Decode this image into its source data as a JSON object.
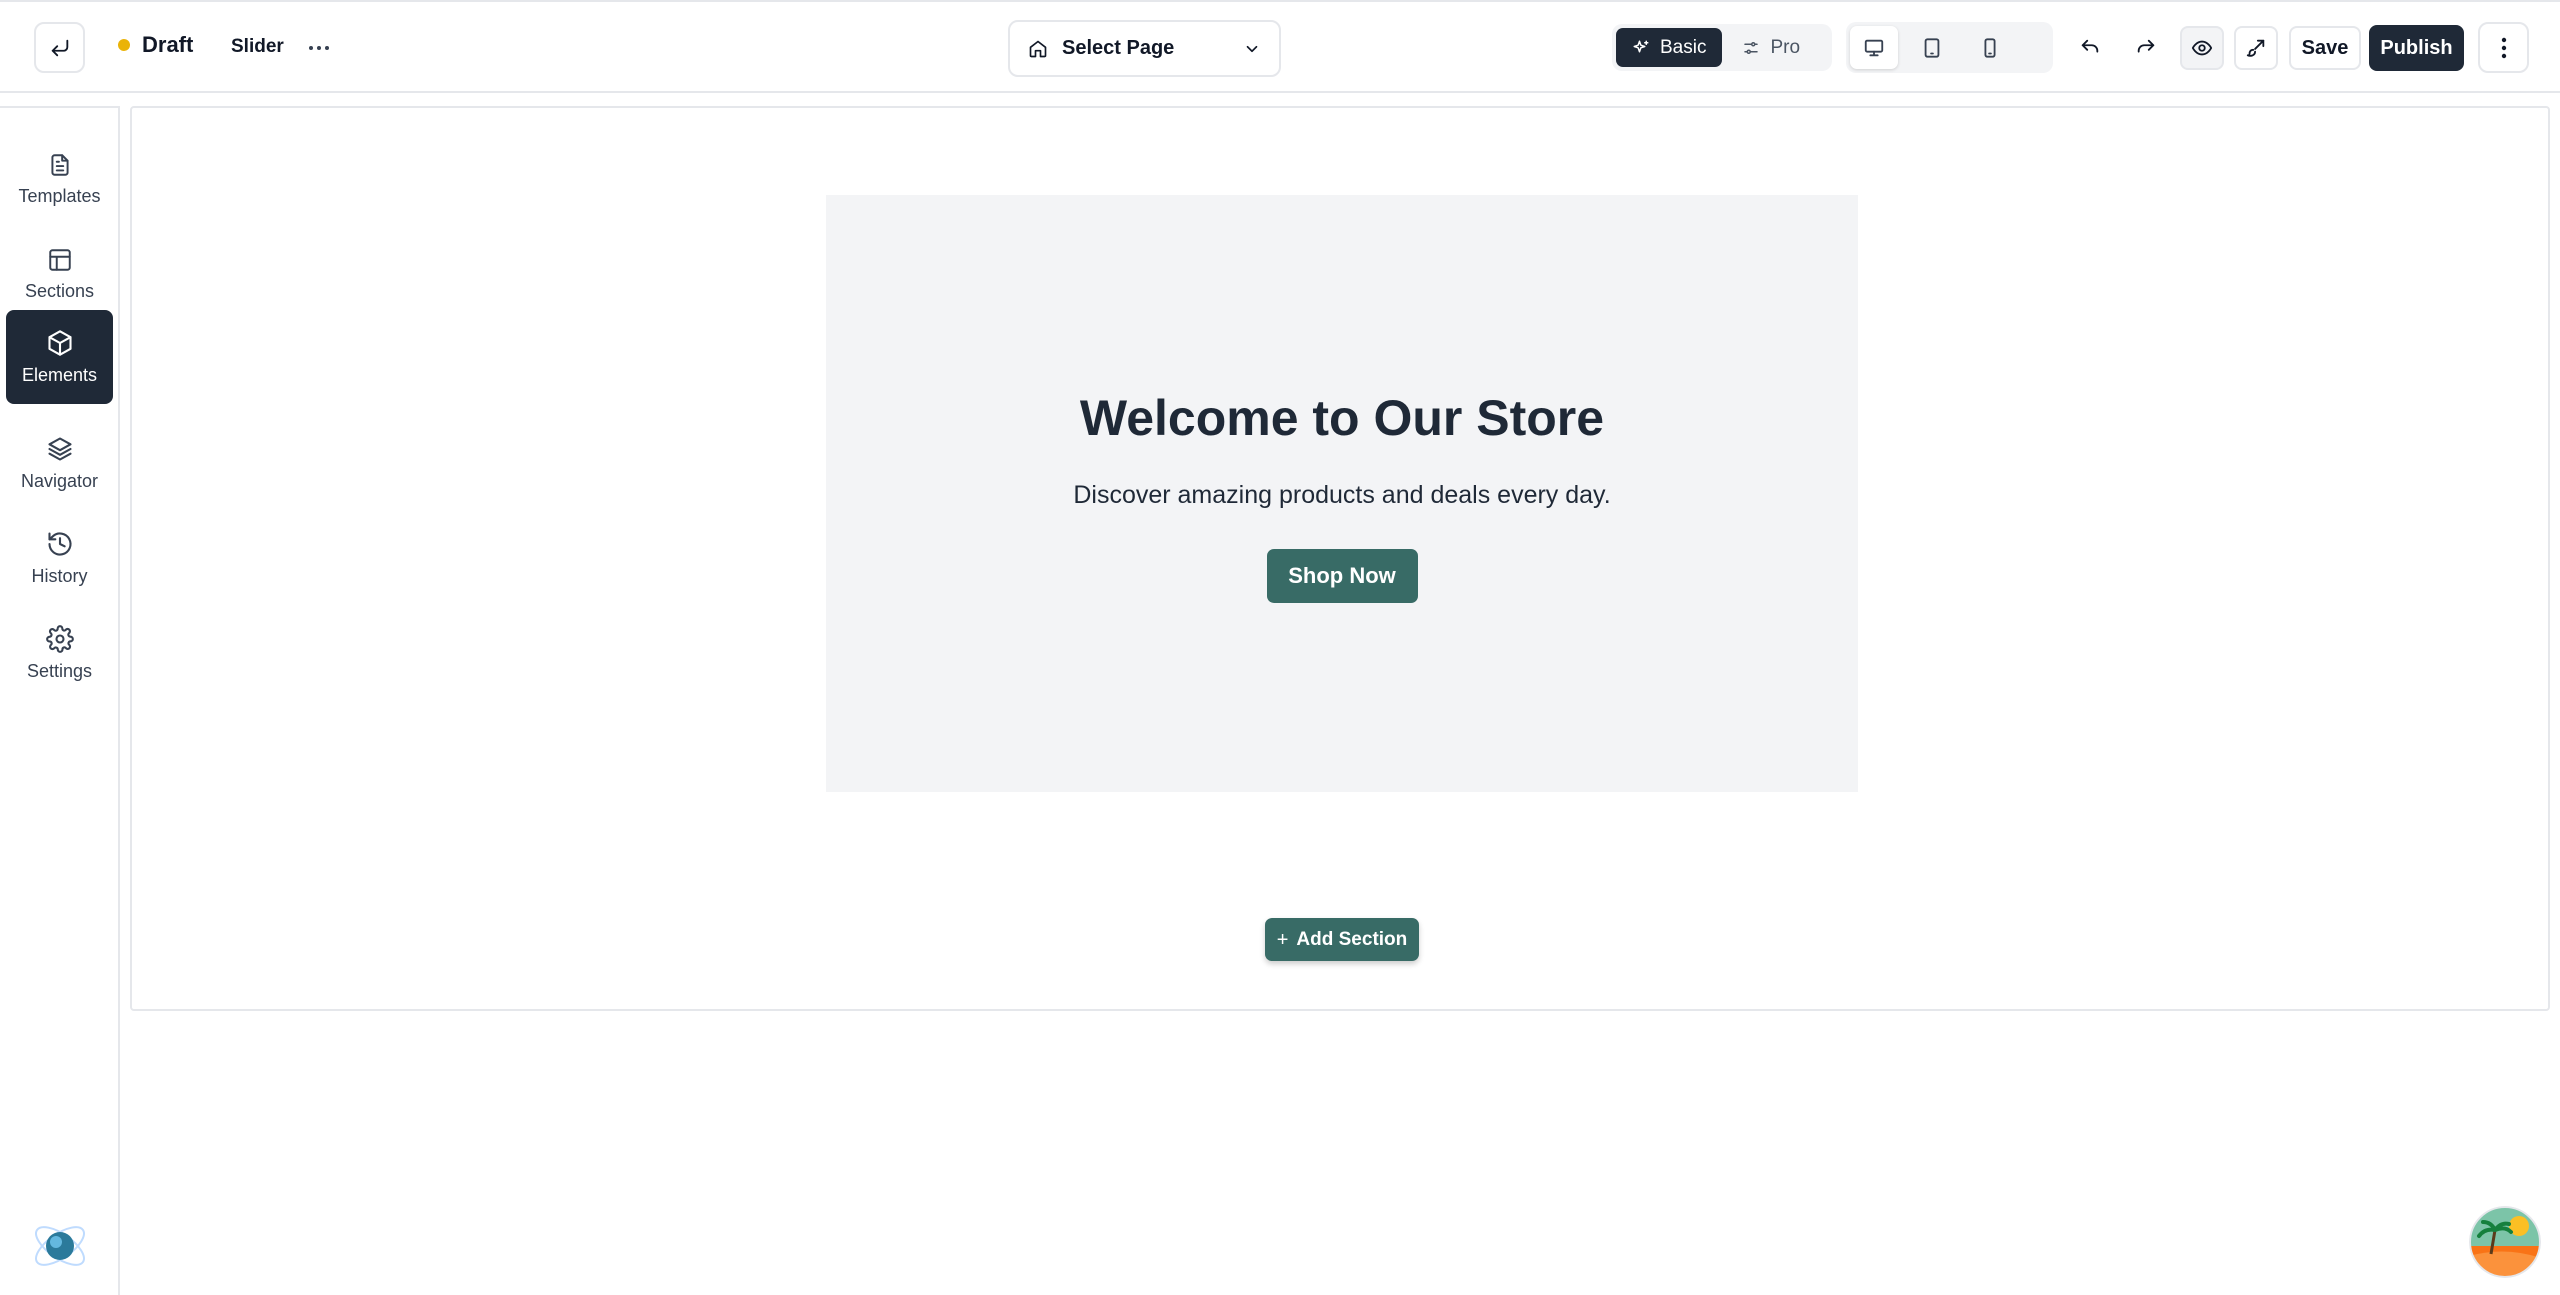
{
  "topbar": {
    "status_label": "Draft",
    "page_name": "Slider",
    "select_page": {
      "label": "Select Page"
    },
    "modes": [
      {
        "label": "Basic",
        "active": true
      },
      {
        "label": "Pro",
        "active": false
      }
    ],
    "devices": [
      "desktop",
      "tablet",
      "mobile"
    ],
    "active_device": "desktop",
    "save_label": "Save",
    "publish_label": "Publish"
  },
  "sidebar": {
    "items": [
      {
        "label": "Templates",
        "icon": "document-icon"
      },
      {
        "label": "Sections",
        "icon": "layout-icon"
      },
      {
        "label": "Elements",
        "icon": "cube-icon",
        "active": true
      },
      {
        "label": "Navigator",
        "icon": "layers-icon"
      },
      {
        "label": "History",
        "icon": "history-icon"
      },
      {
        "label": "Settings",
        "icon": "gear-icon"
      }
    ]
  },
  "canvas": {
    "hero": {
      "title": "Welcome to Our Store",
      "subtitle": "Discover amazing products and deals every day.",
      "cta_label": "Shop Now"
    },
    "add_section_label": "Add Section"
  },
  "colors": {
    "status_dot": "#eab308",
    "dark": "#1f2937",
    "teal": "#386b66",
    "hero_bg": "#f3f4f6"
  }
}
